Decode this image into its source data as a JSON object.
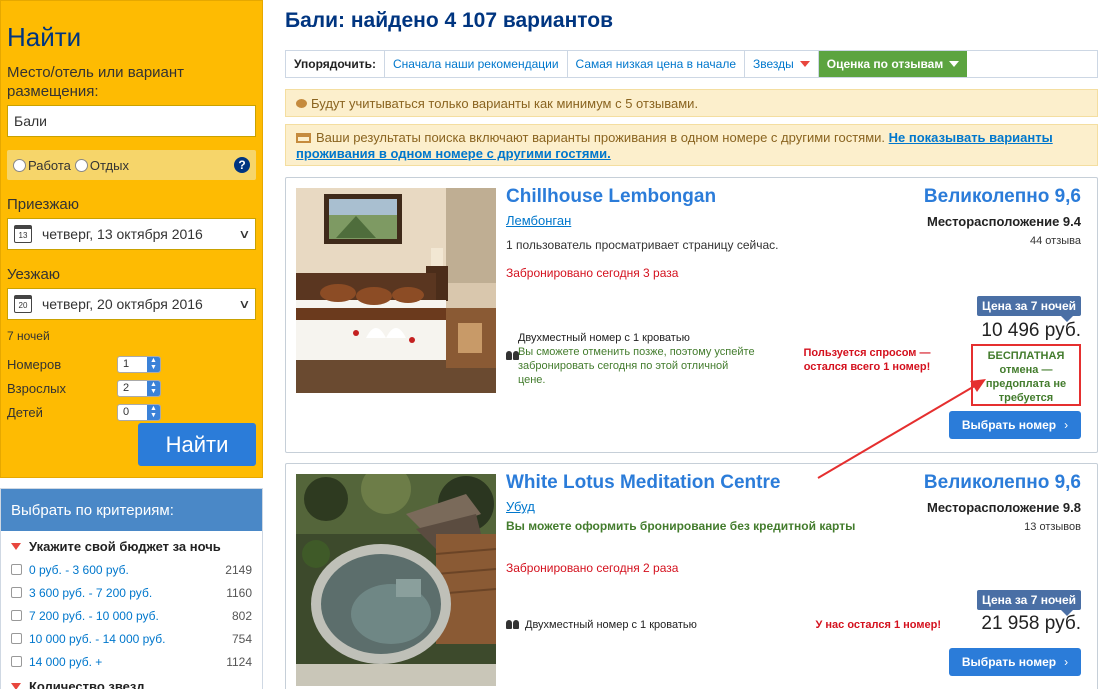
{
  "search": {
    "title": "Найти",
    "destination_label": "Место/отель или вариант размещения:",
    "destination_value": "Бали",
    "purpose_work": "Работа",
    "purpose_leisure": "Отдых",
    "help": "?",
    "checkin_label": "Приезжаю",
    "checkin_value": "четверг, 13 октября 2016",
    "checkin_day": "13",
    "checkout_label": "Уезжаю",
    "checkout_value": "четверг, 20 октября 2016",
    "checkout_day": "20",
    "nights": "7 ночей",
    "rooms_label": "Номеров",
    "rooms_value": "1",
    "adults_label": "Взрослых",
    "adults_value": "2",
    "children_label": "Детей",
    "children_value": "0",
    "submit_label": "Найти"
  },
  "filters": {
    "header": "Выбрать по критериям:",
    "budget_title": "Укажите свой бюджет за ночь",
    "budget": [
      {
        "label": "0 руб. - 3 600 руб.",
        "count": "2149"
      },
      {
        "label": "3 600 руб. - 7 200 руб.",
        "count": "1160"
      },
      {
        "label": "7 200 руб. - 10 000 руб.",
        "count": "802"
      },
      {
        "label": "10 000 руб. - 14 000 руб.",
        "count": "754"
      },
      {
        "label": "14 000 руб. +",
        "count": "1124"
      }
    ],
    "stars_title": "Количество звезд"
  },
  "results": {
    "title": "Бали: найдено 4 107 вариантов"
  },
  "sort": {
    "label": "Упорядочить:",
    "recommended": "Сначала наши рекомендации",
    "lowest_price": "Самая низкая цена в начале",
    "stars": "Звезды",
    "review_score": "Оценка по отзывам"
  },
  "notices": {
    "min_reviews": "Будут учитываться только варианты как минимум с 5 отзывами.",
    "shared_text": "Ваши результаты поиска включают варианты проживания в одном номере с другими гостями.",
    "shared_link": "Не показывать варианты проживания в одном номере с другими гостями."
  },
  "hotels": [
    {
      "name": "Chillhouse Lembongan",
      "city": "Лембонган",
      "viewers": "1 пользователь просматривает страницу сейчас.",
      "booked": "Забронировано сегодня 3 раза",
      "score": "Великолепно 9,6",
      "location": "Месторасположение 9.4",
      "reviews": "44 отзыва",
      "room": "Двухместный номер с 1 кроватью",
      "room_note": "Вы сможете отменить позже, поэтому успейте забронировать сегодня по этой отличной цене.",
      "demand": "Пользуется спросом — остался всего 1 номер!",
      "price_label": "Цена за 7 ночей",
      "price": "10 496 руб.",
      "free_cancel": "БЕСПЛАТНАЯ отмена — предоплата не требуется",
      "button": "Выбрать номер"
    },
    {
      "name": "White Lotus Meditation Centre",
      "city": "Убуд",
      "no_card": "Вы можете оформить бронирование без кредитной карты",
      "booked": "Забронировано сегодня 2 раза",
      "score": "Великолепно 9,6",
      "location": "Месторасположение 9.8",
      "reviews": "13 отзывов",
      "room": "Двухместный номер с 1 кроватью",
      "demand": "У нас остался 1 номер!",
      "price_label": "Цена за 7 ночей",
      "price": "21 958 руб.",
      "button": "Выбрать номер"
    }
  ],
  "colors": {
    "search_bg": "#febb02",
    "brand_blue": "#003580",
    "link_blue": "#2b7cd9",
    "active_sort": "#5ca440",
    "alert_red": "#d4111e",
    "good_green": "#437c2d"
  }
}
